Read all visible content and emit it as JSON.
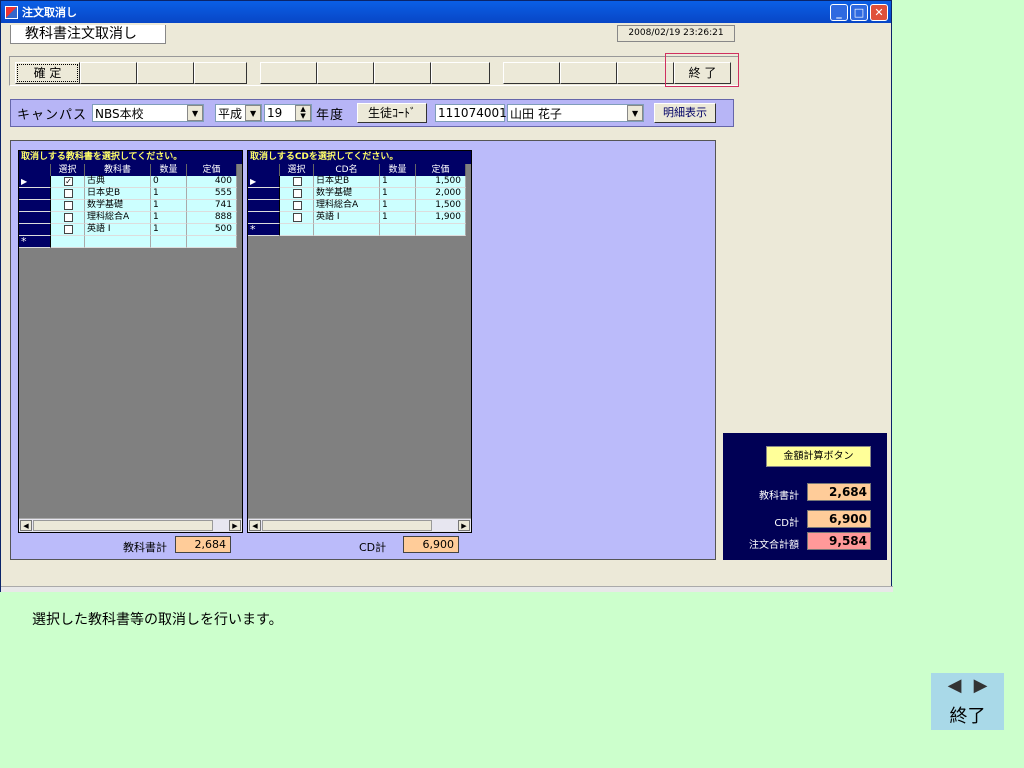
{
  "window": {
    "title": "注文取消し"
  },
  "form": {
    "title": "教科書注文取消し",
    "datetime": "2008/02/19 23:26:21"
  },
  "toolbar": {
    "confirm_label": "確 定",
    "exit_label": "終 了"
  },
  "filter": {
    "campus_label": "キャンパス",
    "campus_value": "NBS本校",
    "era_value": "平成",
    "year_value": "19",
    "year_suffix": "年度",
    "student_code_button": "生徒ｺｰﾄﾞ",
    "student_code": "111074001",
    "student_name": "山田 花子",
    "detail_button": "明細表示"
  },
  "textbooks": {
    "caption": "取消しする教科書を選択してください。",
    "columns": [
      "選択",
      "教科書",
      "数量",
      "定価"
    ],
    "rows": [
      {
        "checked": true,
        "name": "古典",
        "qty": "0",
        "price": "400"
      },
      {
        "checked": false,
        "name": "日本史B",
        "qty": "1",
        "price": "555"
      },
      {
        "checked": false,
        "name": "数学基礎",
        "qty": "1",
        "price": "741"
      },
      {
        "checked": false,
        "name": "理科総合A",
        "qty": "1",
        "price": "888"
      },
      {
        "checked": false,
        "name": "英語 I",
        "qty": "1",
        "price": "500"
      }
    ],
    "total_label": "教科書計",
    "total_value": "2,684"
  },
  "cds": {
    "caption": "取消しするCDを選択してください。",
    "columns": [
      "選択",
      "CD名",
      "数量",
      "定価"
    ],
    "rows": [
      {
        "checked": false,
        "name": "日本史B",
        "qty": "1",
        "price": "1,500"
      },
      {
        "checked": false,
        "name": "数学基礎",
        "qty": "1",
        "price": "2,000"
      },
      {
        "checked": false,
        "name": "理科総合A",
        "qty": "1",
        "price": "1,500"
      },
      {
        "checked": false,
        "name": "英語 I",
        "qty": "1",
        "price": "1,900"
      }
    ],
    "total_label": "CD計",
    "total_value": "6,900"
  },
  "calc": {
    "button_label": "金額計算ボタン",
    "textbook_label": "教科書計",
    "textbook_value": "2,684",
    "cd_label": "CD計",
    "cd_value": "6,900",
    "order_label": "注文合計額",
    "order_value": "9,584",
    "colors": {
      "textbook": "#ffcc99",
      "cd": "#ffcc99",
      "order": "#ff9999"
    }
  },
  "description": "選択した教科書等の取消しを行います。",
  "nav": {
    "prev_icon": "◀",
    "next_icon": "▶",
    "exit_label": "終了"
  }
}
